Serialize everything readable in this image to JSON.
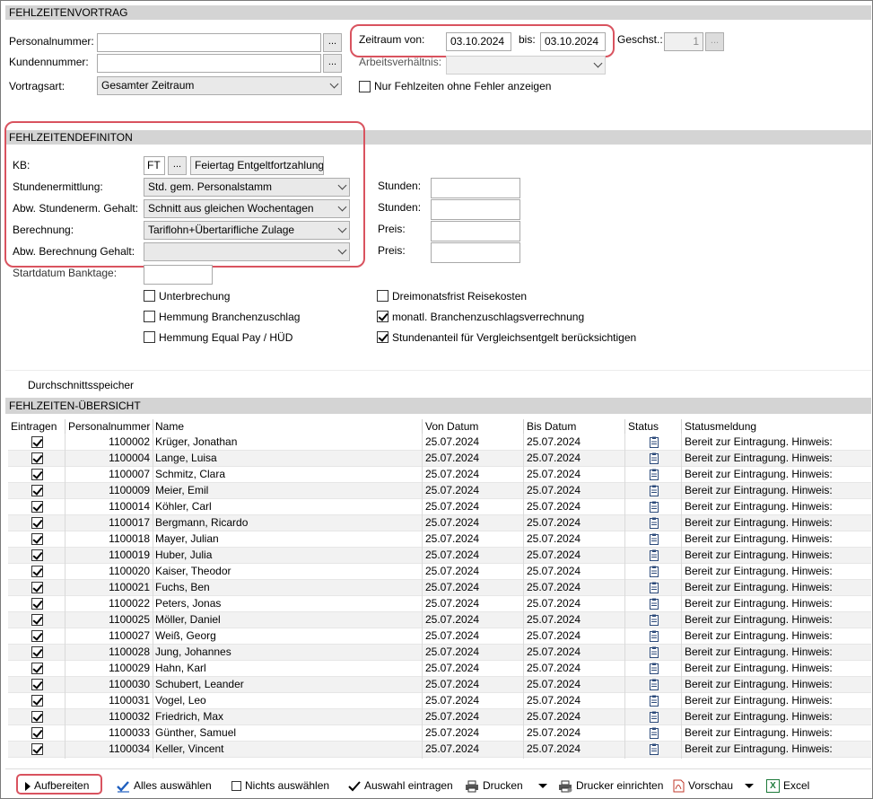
{
  "sections": {
    "vortrag": "FEHLZEITENVORTRAG",
    "definition": "FEHLZEITENDEFINITON",
    "uebersicht": "FEHLZEITEN-ÜBERSICHT"
  },
  "vortrag": {
    "personalnummer_label": "Personalnummer:",
    "personalnummer_value": "",
    "kundennummer_label": "Kundennummer:",
    "kundennummer_value": "",
    "vortragsart_label": "Vortragsart:",
    "vortragsart_value": "Gesamter Zeitraum",
    "zeitraum_von_label": "Zeitraum von:",
    "zeitraum_von_value": "03.10.2024",
    "bis_label": "bis:",
    "bis_value": "03.10.2024",
    "geschst_label": "Geschst.:",
    "geschst_value": "1",
    "arbeitsverhaeltnis_label": "Arbeitsverhältnis:",
    "arbeitsverhaeltnis_value": "",
    "nur_fehlzeiten_label": "Nur Fehlzeiten ohne Fehler anzeigen",
    "nur_fehlzeiten_checked": false,
    "dots": "..."
  },
  "definition": {
    "kb_label": "KB:",
    "kb_code": "FT",
    "kb_text": "Feiertag Entgeltfortzahlung",
    "stundenermittlung_label": "Stundenermittlung:",
    "stundenermittlung_value": "Std. gem. Personalstamm",
    "abw_stundenerm_label": "Abw. Stundenerm. Gehalt:",
    "abw_stundenerm_value": "Schnitt aus gleichen Wochentagen",
    "berechnung_label": "Berechnung:",
    "berechnung_value": "Tariflohn+Übertarifliche Zulage",
    "abw_berechnung_label": "Abw. Berechnung Gehalt:",
    "abw_berechnung_value": "",
    "startdatum_label": "Startdatum Banktage:",
    "startdatum_value": "",
    "stunden_label_1": "Stunden:",
    "stunden_label_2": "Stunden:",
    "preis_label_1": "Preis:",
    "preis_label_2": "Preis:",
    "unterbrechung": "Unterbrechung",
    "hemmung_branchenzuschlag": "Hemmung Branchenzuschlag",
    "hemmung_equal_pay": "Hemmung Equal Pay / HÜD",
    "dreimonatsfrist": "Dreimonatsfrist Reisekosten",
    "monatl_branchenzuschlag": "monatl. Branchenzuschlagsverrechnung",
    "stundenanteil": "Stundenanteil für Vergleichsentgelt berücksichtigen",
    "durchschnittsspeicher": "Durchschnittsspeicher"
  },
  "table": {
    "columns": [
      "Eintragen",
      "Personalnummer",
      "Name",
      "Von Datum",
      "Bis Datum",
      "Status",
      "Statusmeldung"
    ],
    "rows": [
      {
        "nr": "1100002",
        "name": "Krüger, Jonathan",
        "von": "25.07.2024",
        "bis": "25.07.2024",
        "msg": "Bereit zur Eintragung. Hinweis:"
      },
      {
        "nr": "1100004",
        "name": "Lange, Luisa",
        "von": "25.07.2024",
        "bis": "25.07.2024",
        "msg": "Bereit zur Eintragung. Hinweis:"
      },
      {
        "nr": "1100007",
        "name": "Schmitz, Clara",
        "von": "25.07.2024",
        "bis": "25.07.2024",
        "msg": "Bereit zur Eintragung. Hinweis:"
      },
      {
        "nr": "1100009",
        "name": "Meier, Emil",
        "von": "25.07.2024",
        "bis": "25.07.2024",
        "msg": "Bereit zur Eintragung. Hinweis:"
      },
      {
        "nr": "1100014",
        "name": "Köhler, Carl",
        "von": "25.07.2024",
        "bis": "25.07.2024",
        "msg": "Bereit zur Eintragung. Hinweis:"
      },
      {
        "nr": "1100017",
        "name": "Bergmann, Ricardo",
        "von": "25.07.2024",
        "bis": "25.07.2024",
        "msg": "Bereit zur Eintragung. Hinweis:"
      },
      {
        "nr": "1100018",
        "name": "Mayer, Julian",
        "von": "25.07.2024",
        "bis": "25.07.2024",
        "msg": "Bereit zur Eintragung. Hinweis:"
      },
      {
        "nr": "1100019",
        "name": "Huber, Julia",
        "von": "25.07.2024",
        "bis": "25.07.2024",
        "msg": "Bereit zur Eintragung. Hinweis:"
      },
      {
        "nr": "1100020",
        "name": "Kaiser, Theodor",
        "von": "25.07.2024",
        "bis": "25.07.2024",
        "msg": "Bereit zur Eintragung. Hinweis:"
      },
      {
        "nr": "1100021",
        "name": "Fuchs, Ben",
        "von": "25.07.2024",
        "bis": "25.07.2024",
        "msg": "Bereit zur Eintragung. Hinweis:"
      },
      {
        "nr": "1100022",
        "name": "Peters, Jonas",
        "von": "25.07.2024",
        "bis": "25.07.2024",
        "msg": "Bereit zur Eintragung. Hinweis:"
      },
      {
        "nr": "1100025",
        "name": "Möller, Daniel",
        "von": "25.07.2024",
        "bis": "25.07.2024",
        "msg": "Bereit zur Eintragung. Hinweis:"
      },
      {
        "nr": "1100027",
        "name": "Weiß, Georg",
        "von": "25.07.2024",
        "bis": "25.07.2024",
        "msg": "Bereit zur Eintragung. Hinweis:"
      },
      {
        "nr": "1100028",
        "name": "Jung, Johannes",
        "von": "25.07.2024",
        "bis": "25.07.2024",
        "msg": "Bereit zur Eintragung. Hinweis:"
      },
      {
        "nr": "1100029",
        "name": "Hahn, Karl",
        "von": "25.07.2024",
        "bis": "25.07.2024",
        "msg": "Bereit zur Eintragung. Hinweis:"
      },
      {
        "nr": "1100030",
        "name": "Schubert, Leander",
        "von": "25.07.2024",
        "bis": "25.07.2024",
        "msg": "Bereit zur Eintragung. Hinweis:"
      },
      {
        "nr": "1100031",
        "name": "Vogel, Leo",
        "von": "25.07.2024",
        "bis": "25.07.2024",
        "msg": "Bereit zur Eintragung. Hinweis:"
      },
      {
        "nr": "1100032",
        "name": "Friedrich, Max",
        "von": "25.07.2024",
        "bis": "25.07.2024",
        "msg": "Bereit zur Eintragung. Hinweis:"
      },
      {
        "nr": "1100033",
        "name": "Günther, Samuel",
        "von": "25.07.2024",
        "bis": "25.07.2024",
        "msg": "Bereit zur Eintragung. Hinweis:"
      },
      {
        "nr": "1100034",
        "name": "Keller, Vincent",
        "von": "25.07.2024",
        "bis": "25.07.2024",
        "msg": "Bereit zur Eintragung. Hinweis:"
      }
    ]
  },
  "toolbar": {
    "aufbereiten": "Aufbereiten",
    "alles_auswaehlen": "Alles auswählen",
    "nichts_auswaehlen": "Nichts auswählen",
    "auswahl_eintragen": "Auswahl eintragen",
    "drucken": "Drucken",
    "drucker_einrichten": "Drucker einrichten",
    "vorschau": "Vorschau",
    "excel": "Excel"
  },
  "colors": {
    "highlight_red": "#d9535f",
    "section_gray": "#d4d4d4",
    "row_alt": "#f2f2f2",
    "excel_green": "#1d7a3a",
    "pdf_red": "#c0392b"
  }
}
